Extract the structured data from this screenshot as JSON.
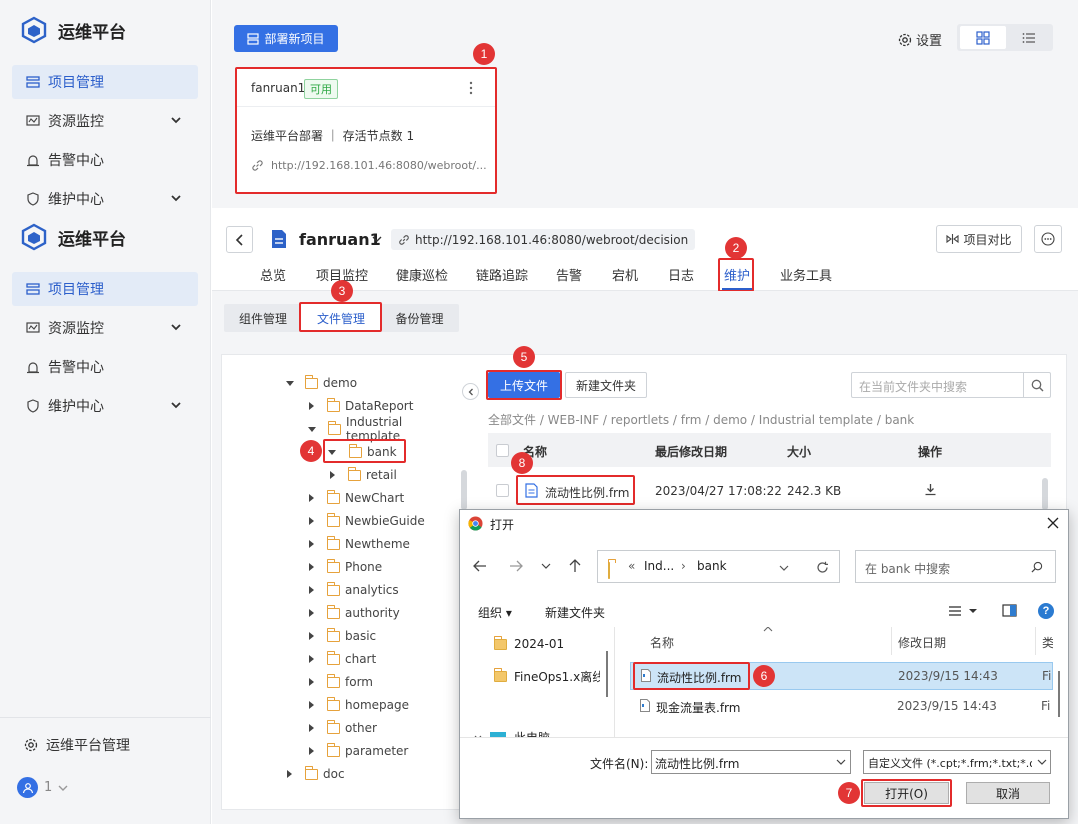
{
  "app": {
    "name": "运维平台"
  },
  "sidebar": {
    "items": [
      {
        "label": "项目管理"
      },
      {
        "label": "资源监控"
      },
      {
        "label": "告警中心"
      },
      {
        "label": "维护中心"
      }
    ],
    "footer_label": "运维平台管理",
    "user_label": "1"
  },
  "top": {
    "deploy_button": "部署新项目",
    "settings_label": "设置"
  },
  "project_card": {
    "name": "fanruan1",
    "status": "可用",
    "description": "运维平台部署 ｜ 存活节点数 1",
    "url": "http://192.168.101.46:8080/webroot/..."
  },
  "project_header": {
    "name": "fanruan1",
    "url": "http://192.168.101.46:8080/webroot/decision",
    "compare_button": "项目对比"
  },
  "tabs": [
    "总览",
    "项目监控",
    "健康巡检",
    "链路追踪",
    "告警",
    "宕机",
    "日志",
    "维护",
    "业务工具"
  ],
  "subtabs": [
    "组件管理",
    "文件管理",
    "备份管理"
  ],
  "tree": [
    "demo",
    "DataReport",
    "Industrial template",
    "bank",
    "retail",
    "NewChart",
    "NewbieGuide",
    "Newtheme",
    "Phone",
    "analytics",
    "authority",
    "basic",
    "chart",
    "form",
    "homepage",
    "other",
    "parameter",
    "doc"
  ],
  "files": {
    "upload_button": "上传文件",
    "new_folder_button": "新建文件夹",
    "search_placeholder": "在当前文件夹中搜索",
    "breadcrumb": "全部文件 / WEB-INF / reportlets / frm / demo / Industrial template / bank",
    "columns": [
      "名称",
      "最后修改日期",
      "大小",
      "操作"
    ],
    "rows": [
      {
        "name": "流动性比例.frm",
        "date": "2023/04/27 17:08:22",
        "size": "242.3 KB"
      }
    ]
  },
  "dialog": {
    "title": "打开",
    "path_prefix": "«",
    "path_part1": "Ind...",
    "path_sep": "›",
    "path_part2": "bank",
    "search_placeholder": "在 bank 中搜索",
    "organize": "组织 ▾",
    "new_folder": "新建文件夹",
    "left_items": [
      "2024-01",
      "FineOps1.x离线",
      "此电脑"
    ],
    "columns": [
      "名称",
      "修改日期",
      "类"
    ],
    "rows": [
      {
        "name": "流动性比例.frm",
        "date": "2023/9/15 14:43",
        "type": "Fi"
      },
      {
        "name": "现金流量表.frm",
        "date": "2023/9/15 14:43",
        "type": "Fi"
      }
    ],
    "filename_label": "文件名(N):",
    "filename_value": "流动性比例.frm",
    "filter_value": "自定义文件 (*.cpt;*.frm;*.txt;*.o",
    "open_button": "打开(O)",
    "cancel_button": "取消"
  },
  "badges": [
    "1",
    "2",
    "3",
    "4",
    "5",
    "6",
    "7",
    "8"
  ],
  "colors": {
    "primary": "#3470e4",
    "highlight": "#e32b2b",
    "success": "#2fa845",
    "sidebar_bg": "#f4f5f7"
  }
}
